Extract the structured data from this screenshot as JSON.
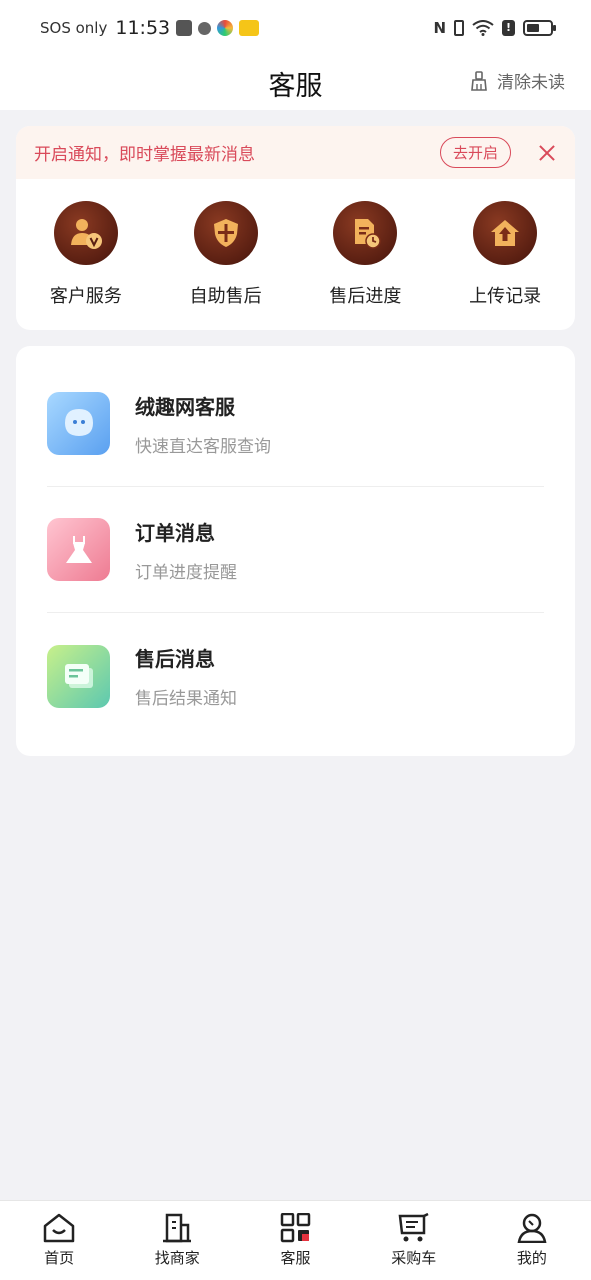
{
  "status_bar": {
    "carrier": "SOS only",
    "time": "11:53",
    "battery_level": 0.55
  },
  "header": {
    "title": "客服",
    "clear_unread": "清除未读",
    "clear_icon": "broom-icon"
  },
  "notice": {
    "text": "开启通知，即时掌握最新消息",
    "button": "去开启",
    "accent": "#d94a5a"
  },
  "quick_actions": [
    {
      "label": "客户服务",
      "icon": "customer-service-icon"
    },
    {
      "label": "自助售后",
      "icon": "shield-icon"
    },
    {
      "label": "售后进度",
      "icon": "progress-doc-icon"
    },
    {
      "label": "上传记录",
      "icon": "upload-icon"
    }
  ],
  "messages": [
    {
      "title": "绒趣网客服",
      "subtitle": "快速直达客服查询",
      "icon": "chat-bubble-icon",
      "color": "#5aa0f0"
    },
    {
      "title": "订单消息",
      "subtitle": "订单进度提醒",
      "icon": "dress-icon",
      "color": "#ee7b92"
    },
    {
      "title": "售后消息",
      "subtitle": "售后结果通知",
      "icon": "message-card-icon",
      "color": "#6cd4a6"
    }
  ],
  "bottom_nav": [
    {
      "label": "首页",
      "icon": "home-icon"
    },
    {
      "label": "找商家",
      "icon": "building-icon"
    },
    {
      "label": "客服",
      "icon": "service-grid-icon",
      "active": true
    },
    {
      "label": "采购车",
      "icon": "cart-icon"
    },
    {
      "label": "我的",
      "icon": "profile-icon"
    }
  ]
}
